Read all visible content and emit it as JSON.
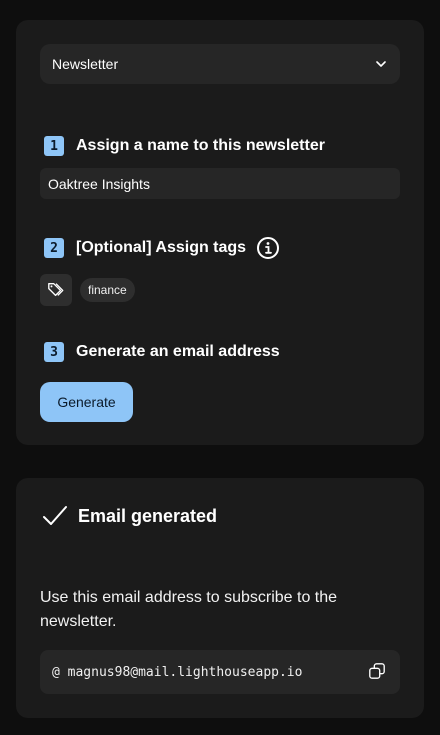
{
  "setup": {
    "type_select": {
      "value": "Newsletter",
      "icon": "chevron-down-icon"
    },
    "step1": {
      "number": "1",
      "label": "Assign a name to this newsletter",
      "input_value": "Oaktree Insights"
    },
    "step2": {
      "number": "2",
      "label": "[Optional] Assign tags",
      "info_icon": "info-icon",
      "tag_icon": "tag-icon",
      "tags": [
        "finance"
      ]
    },
    "step3": {
      "number": "3",
      "label": "Generate an email address",
      "button_label": "Generate"
    }
  },
  "result": {
    "title": "Email generated",
    "check_icon": "check-icon",
    "description": "Use this email address to subscribe to the newsletter.",
    "email": "@ magnus98@mail.lighthouseapp.io",
    "copy_icon": "copy-icon"
  },
  "colors": {
    "accent": "#8ec5f7",
    "card_bg": "#1b1b1b",
    "page_bg": "#0e0e0e",
    "field_bg": "#262626"
  }
}
